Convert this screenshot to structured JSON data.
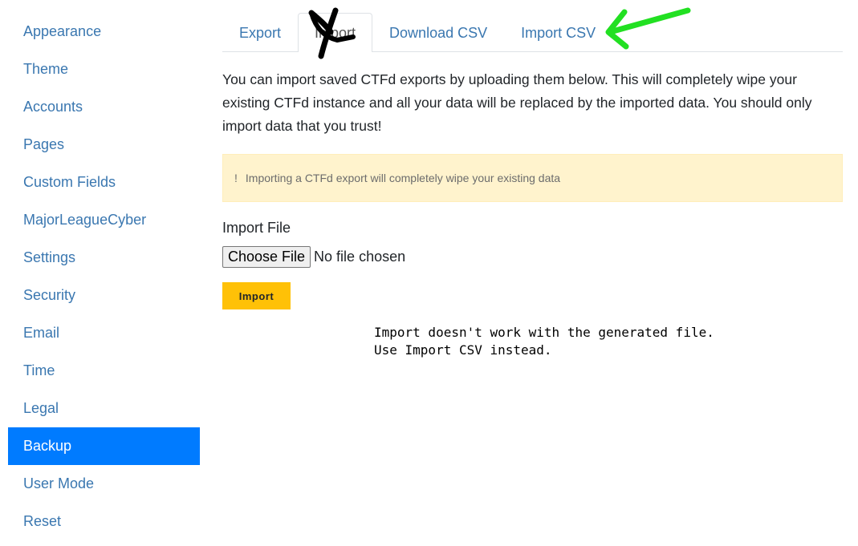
{
  "sidebar": {
    "items": [
      {
        "label": "Appearance"
      },
      {
        "label": "Theme"
      },
      {
        "label": "Accounts"
      },
      {
        "label": "Pages"
      },
      {
        "label": "Custom Fields"
      },
      {
        "label": "MajorLeagueCyber"
      },
      {
        "label": "Settings"
      },
      {
        "label": "Security"
      },
      {
        "label": "Email"
      },
      {
        "label": "Time"
      },
      {
        "label": "Legal"
      },
      {
        "label": "Backup"
      },
      {
        "label": "User Mode"
      },
      {
        "label": "Reset"
      }
    ],
    "active": "Backup"
  },
  "tabs": [
    {
      "label": "Export"
    },
    {
      "label": "Import"
    },
    {
      "label": "Download CSV"
    },
    {
      "label": "Import CSV"
    }
  ],
  "active_tab": "Import",
  "intro": "You can import saved CTFd exports by uploading them below. This will completely wipe your existing CTFd instance and all your data will be replaced by the imported data. You should only import data that you trust!",
  "alert": {
    "icon": "!",
    "text": "Importing a CTFd export will completely wipe your existing data"
  },
  "import_file": {
    "label": "Import File",
    "choose_button": "Choose File",
    "status": "No file chosen"
  },
  "import_button": "Import",
  "annotation": {
    "note": "Import doesn't work with the generated file.\nUse Import CSV instead.",
    "cross_color": "#000000",
    "arrow_color": "#22e022"
  }
}
